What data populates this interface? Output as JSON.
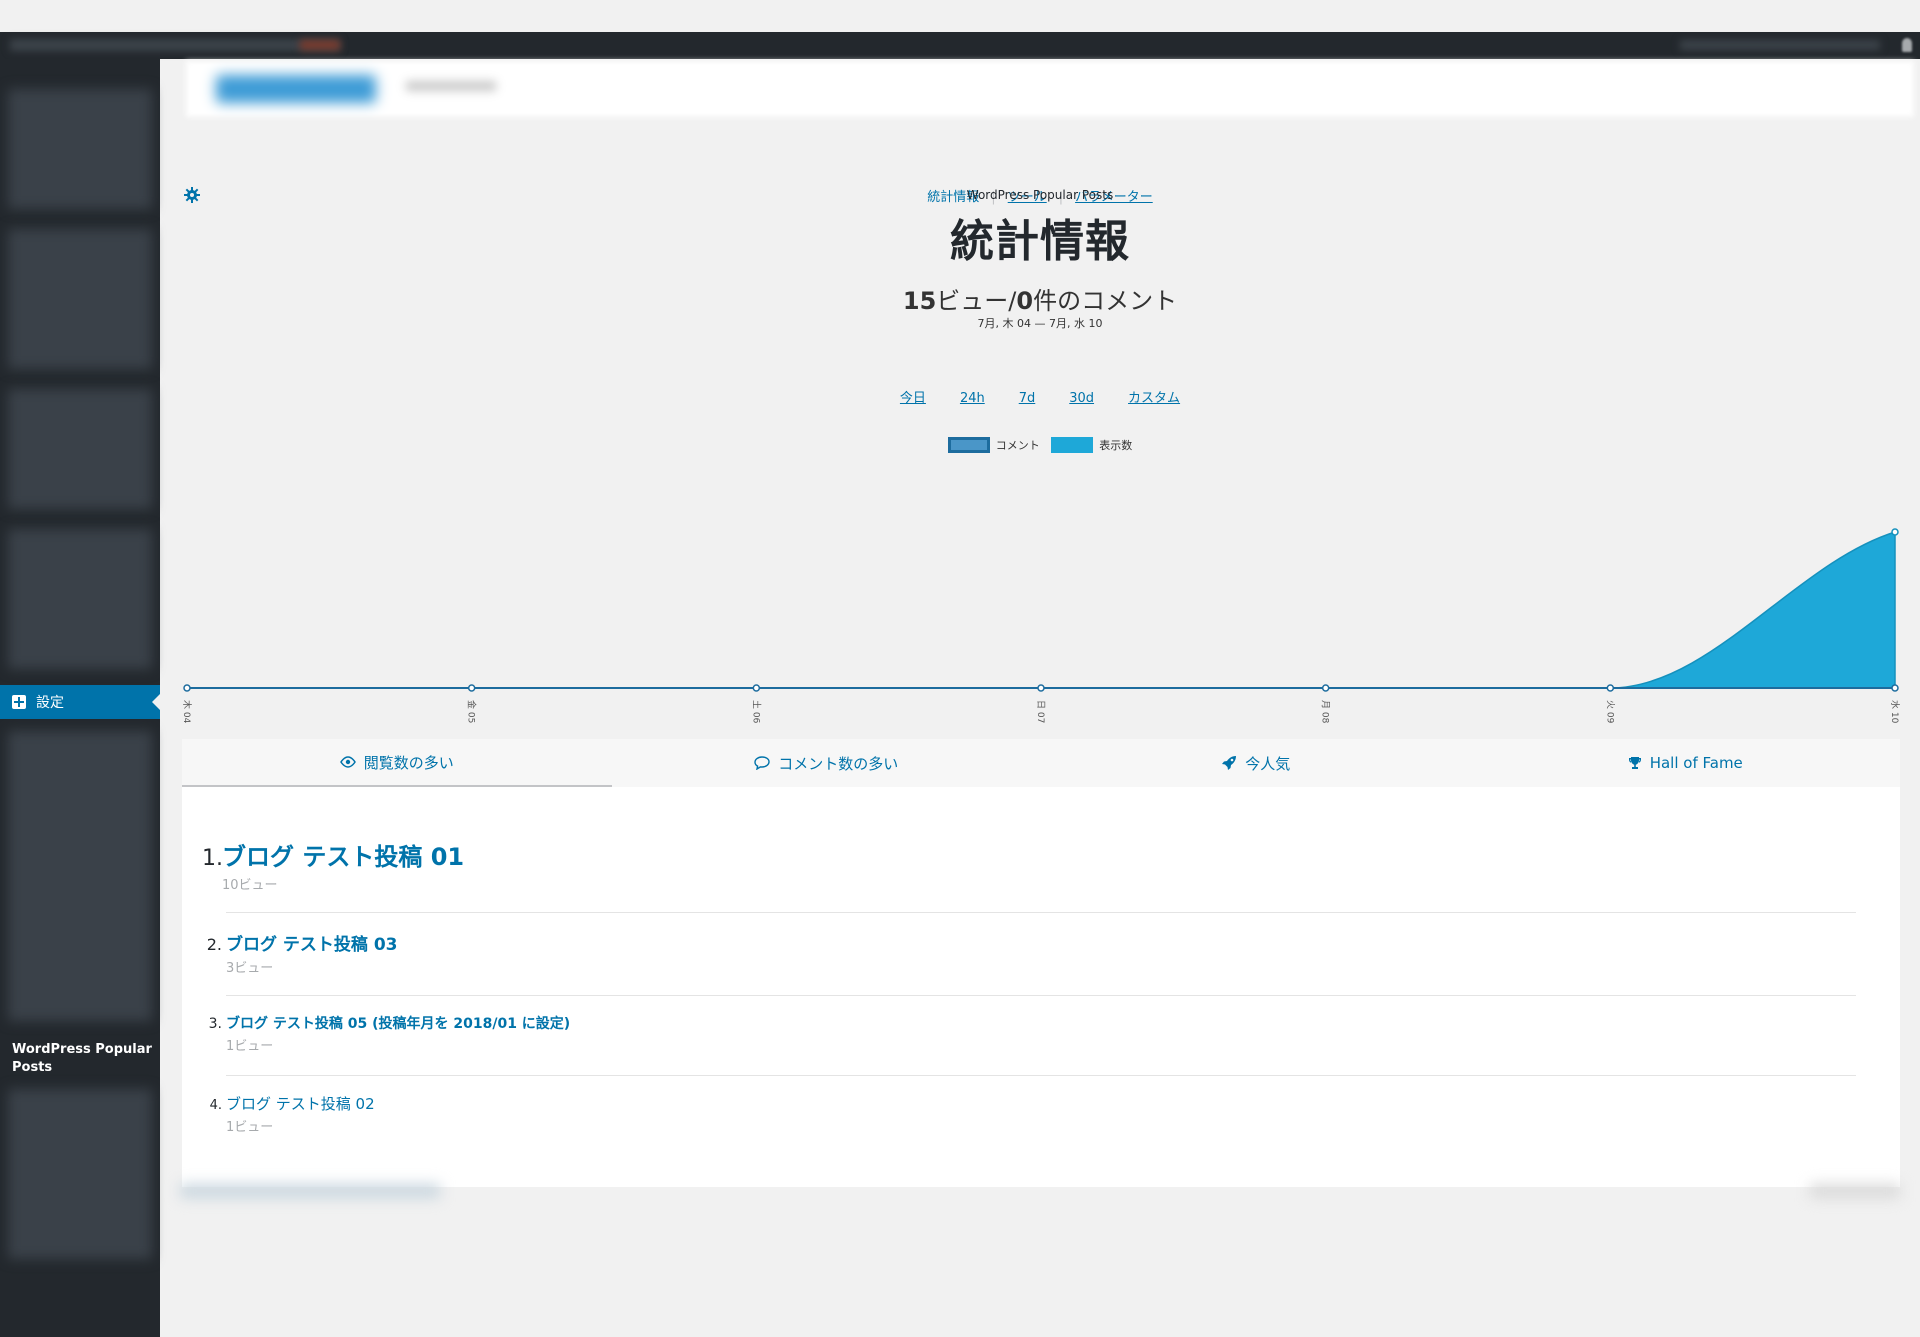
{
  "subnav": {
    "items": [
      "統計情報",
      "ツール",
      "パラメーター"
    ],
    "separator": "|"
  },
  "sidebar": {
    "active_label": "設定",
    "plugin_label": "WordPress Popular Posts"
  },
  "header": {
    "plugin_name": "WordPress Popular Posts",
    "title": "統計情報"
  },
  "summary": {
    "views_count": "15",
    "views_unit": "ビュー",
    "slash": "/",
    "comments_count": "0",
    "comments_unit": "件のコメント",
    "date_range": "7月, 木 04 — 7月, 水 10"
  },
  "time_ranges": [
    "今日",
    "24h",
    "7d",
    "30d",
    "カスタム"
  ],
  "legend": {
    "comments": "コメント",
    "views": "表示数"
  },
  "colors": {
    "accent": "#0073aa",
    "views_fill": "#1ea8d8",
    "comments_line": "#1d6c9e",
    "sidebar_bg": "#23282d"
  },
  "chart_data": {
    "type": "area",
    "x": [
      "木 04",
      "金 05",
      "土 06",
      "日 07",
      "月 08",
      "火 09",
      "水 10"
    ],
    "series": [
      {
        "name": "コメント",
        "values": [
          0,
          0,
          0,
          0,
          0,
          0,
          0
        ]
      },
      {
        "name": "表示数",
        "values": [
          0,
          0,
          0,
          0,
          0,
          0,
          15
        ]
      }
    ],
    "ylim": [
      0,
      15
    ],
    "legend": "top"
  },
  "tabs": [
    {
      "label": "閲覧数の多い",
      "icon": "eye-icon"
    },
    {
      "label": "コメント数の多い",
      "icon": "comment-icon"
    },
    {
      "label": "今人気",
      "icon": "rocket-icon"
    },
    {
      "label": "Hall of Fame",
      "icon": "trophy-icon"
    }
  ],
  "posts": [
    {
      "rank": "1.",
      "title": "ブログ テスト投稿 01",
      "views": "10ビュー"
    },
    {
      "rank": "2.",
      "title": "ブログ テスト投稿 03",
      "views": "3ビュー"
    },
    {
      "rank": "3.",
      "title": "ブログ テスト投稿 05 (投稿年月を 2018/01 に設定)",
      "views": "1ビュー"
    },
    {
      "rank": "4.",
      "title": "ブログ テスト投稿 02",
      "views": "1ビュー"
    }
  ]
}
